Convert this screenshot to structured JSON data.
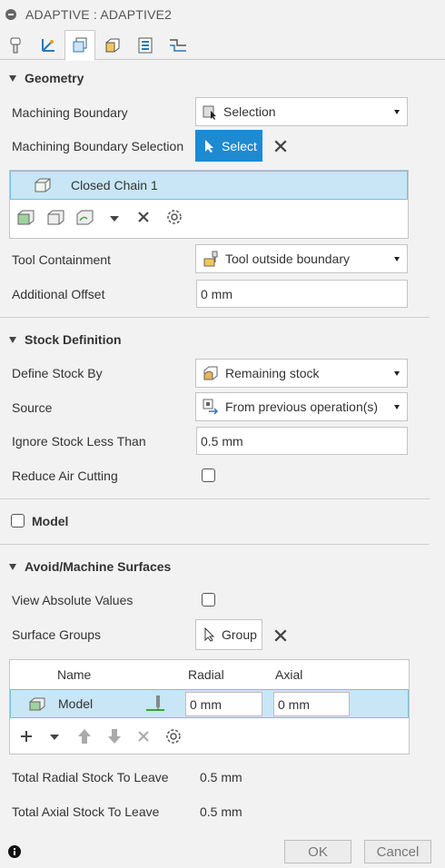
{
  "window": {
    "title": "ADAPTIVE : ADAPTIVE2"
  },
  "tabs": [
    {
      "name": "tool-icon"
    },
    {
      "name": "tool-axis-icon"
    },
    {
      "name": "geometry-icon",
      "active": true
    },
    {
      "name": "heights-icon"
    },
    {
      "name": "passes-icon"
    },
    {
      "name": "linking-icon"
    }
  ],
  "geometry": {
    "header": "Geometry",
    "machining_boundary_label": "Machining Boundary",
    "machining_boundary_value": "Selection",
    "boundary_selection_label": "Machining Boundary Selection",
    "select_button": "Select",
    "selected_item": "Closed Chain 1",
    "tool_containment_label": "Tool Containment",
    "tool_containment_value": "Tool outside boundary",
    "additional_offset_label": "Additional Offset",
    "additional_offset_value": "0 mm"
  },
  "stock": {
    "header": "Stock Definition",
    "define_stock_label": "Define Stock By",
    "define_stock_value": "Remaining stock",
    "source_label": "Source",
    "source_value": "From previous operation(s)",
    "ignore_label": "Ignore Stock Less Than",
    "ignore_value": "0.5 mm",
    "reduce_air_label": "Reduce Air Cutting"
  },
  "model": {
    "header": "Model"
  },
  "avoid": {
    "header": "Avoid/Machine Surfaces",
    "view_absolute_label": "View Absolute Values",
    "surface_groups_label": "Surface Groups",
    "group_button": "Group",
    "table": {
      "columns": [
        "Name",
        "Radial",
        "Axial"
      ],
      "rows": [
        {
          "name": "Model",
          "radial": "0 mm",
          "axial": "0 mm"
        }
      ]
    },
    "total_radial_label": "Total Radial Stock To Leave",
    "total_radial_value": "0.5 mm",
    "total_axial_label": "Total Axial Stock To Leave",
    "total_axial_value": "0.5 mm"
  },
  "footer": {
    "ok": "OK",
    "cancel": "Cancel"
  },
  "colors": {
    "accent": "#1e8ad1",
    "selection": "#c8e6f5"
  }
}
